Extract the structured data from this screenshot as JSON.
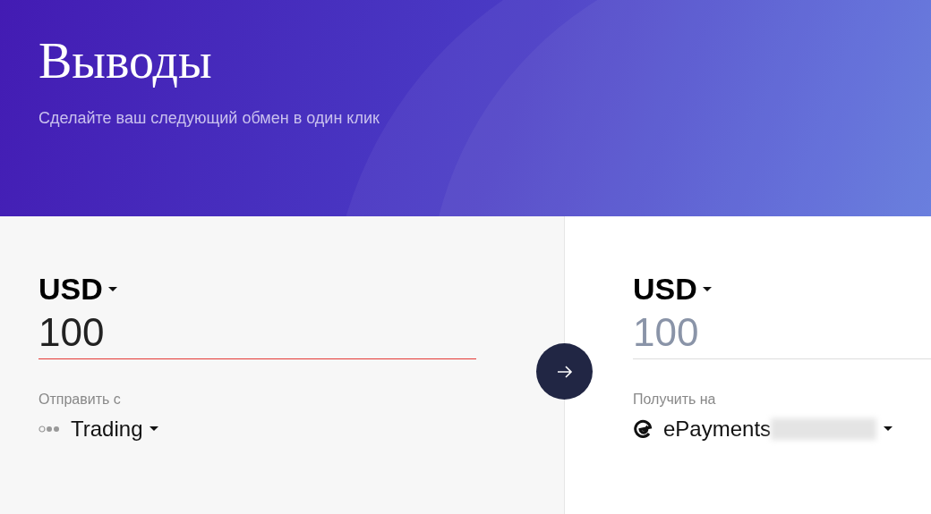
{
  "header": {
    "title": "Выводы",
    "subtitle": "Сделайте ваш следующий обмен в один клик"
  },
  "panels": [
    {
      "kind": "send",
      "currency": "USD",
      "amount": {
        "value": "100",
        "invalid": true
      },
      "account_label": "Отправить с",
      "account": {
        "kind": "wallet",
        "name": "Trading",
        "redacted": false
      }
    },
    {
      "kind": "receive",
      "currency": "USD",
      "amount": {
        "placeholder": "100",
        "invalid": false
      },
      "account_label": "Получить на",
      "account": {
        "kind": "epayments",
        "name": "ePayments",
        "redacted": true
      }
    }
  ]
}
